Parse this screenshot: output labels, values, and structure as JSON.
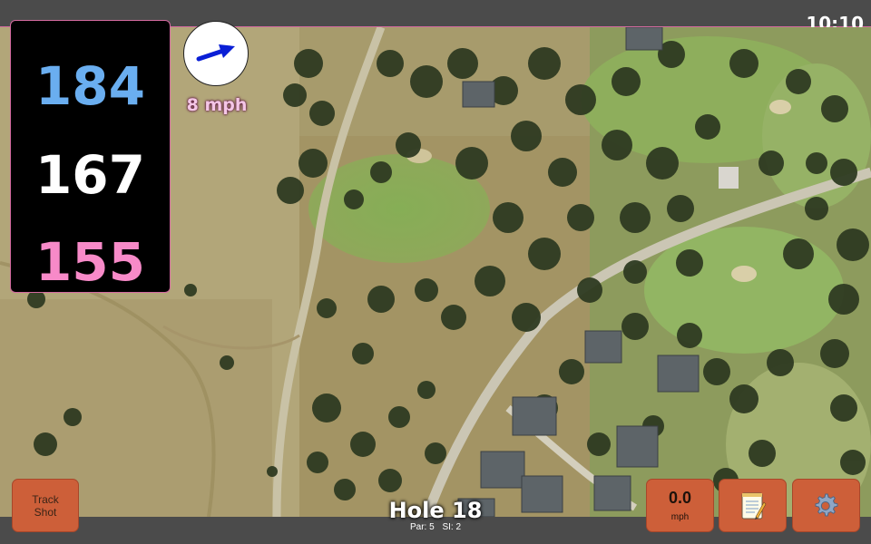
{
  "status": {
    "time": "10:10"
  },
  "yardages": {
    "back": {
      "value": "184",
      "color": "#6aaef0"
    },
    "middle": {
      "value": "167",
      "color": "#ffffff"
    },
    "front": {
      "value": "155",
      "color": "#f78ac8"
    }
  },
  "wind": {
    "speed": "8 mph",
    "arrow_color": "#0a1fd6",
    "icon": "wind-direction-arrow"
  },
  "buttons": {
    "track_shot": {
      "label_line1": "Track",
      "label_line2": "Shot"
    },
    "speed": {
      "value": "0.0",
      "unit": "mph"
    },
    "notes": {
      "icon": "notepad-icon"
    },
    "settings": {
      "icon": "gear-icon"
    },
    "button_color": "#cd5f39"
  },
  "hole": {
    "title": "Hole 18",
    "par": "Par: 5",
    "si": "SI: 2"
  },
  "map": {
    "style": "satellite-aerial"
  },
  "colors": {
    "bar": "#4b4b4b",
    "accent_pink": "#d46aa0"
  }
}
